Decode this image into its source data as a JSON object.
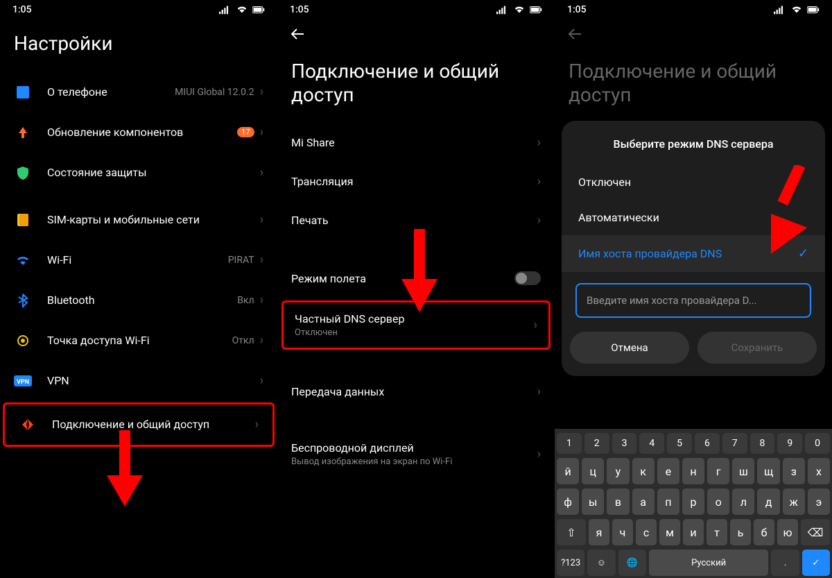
{
  "status": {
    "time": "1:05"
  },
  "screen1": {
    "title": "Настройки",
    "items": [
      {
        "label": "О телефоне",
        "side": "MIUI Global 12.0.2",
        "icon": "about"
      },
      {
        "label": "Обновление компонентов",
        "badge": "17",
        "icon": "update"
      },
      {
        "label": "Состояние защиты",
        "icon": "shield"
      }
    ],
    "net_items": [
      {
        "label": "SIM-карты и мобильные сети",
        "icon": "sim"
      },
      {
        "label": "Wi-Fi",
        "side": "PIRAT",
        "icon": "wifi"
      },
      {
        "label": "Bluetooth",
        "side": "Вкл",
        "icon": "bt"
      },
      {
        "label": "Точка доступа Wi-Fi",
        "side": "Откл",
        "icon": "hotspot"
      },
      {
        "label": "VPN",
        "icon": "vpn"
      },
      {
        "label": "Подключение и общий доступ",
        "icon": "share"
      }
    ]
  },
  "screen2": {
    "title": "Подключение и общий доступ",
    "items_a": [
      {
        "label": "Mi Share"
      },
      {
        "label": "Трансляция"
      },
      {
        "label": "Печать"
      }
    ],
    "airplane": {
      "label": "Режим полета"
    },
    "dns": {
      "label": "Частный DNS сервер",
      "sub": "Отключен"
    },
    "data": {
      "label": "Передача данных"
    },
    "wireless": {
      "label": "Беспроводной дисплей",
      "sub": "Вывод изображения на экран по Wi-Fi"
    }
  },
  "screen3": {
    "title": "Подключение и общий доступ",
    "dialog": {
      "title": "Выберите режим DNS сервера",
      "opts": [
        "Отключен",
        "Автоматически",
        "Имя хоста провайдера DNS"
      ],
      "placeholder": "Введите имя хоста провайдера D...",
      "cancel": "Отмена",
      "save": "Сохранить"
    },
    "kb": {
      "nums": [
        "1",
        "2",
        "3",
        "4",
        "5",
        "6",
        "7",
        "8",
        "9",
        "0"
      ],
      "r1": [
        "й",
        "ц",
        "у",
        "к",
        "е",
        "н",
        "г",
        "ш",
        "щ",
        "з",
        "х"
      ],
      "r2": [
        "ф",
        "ы",
        "в",
        "а",
        "п",
        "р",
        "о",
        "л",
        "д",
        "ж",
        "э"
      ],
      "r3": [
        "я",
        "ч",
        "с",
        "м",
        "и",
        "т",
        "ь",
        "б",
        "ю"
      ],
      "sym": "?123",
      "lang": "Русский"
    }
  }
}
